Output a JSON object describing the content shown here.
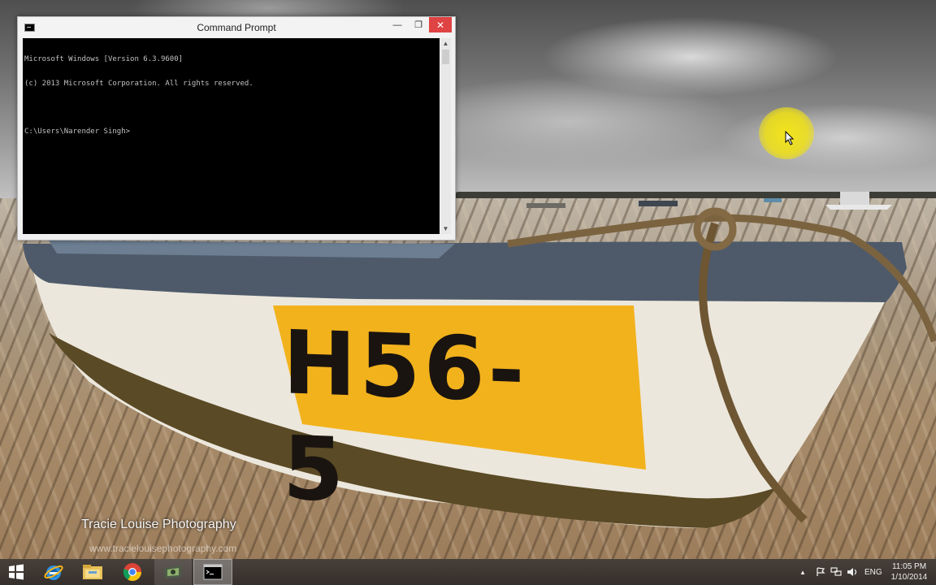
{
  "window": {
    "title": "Command Prompt",
    "minimize_glyph": "—",
    "maximize_glyph": "❐",
    "close_glyph": "✕"
  },
  "console": {
    "lines": [
      "Microsoft Windows [Version 6.3.9600]",
      "(c) 2013 Microsoft Corporation. All rights reserved.",
      "",
      "C:\\Users\\Narender Singh>"
    ]
  },
  "wallpaper": {
    "boat_number": "H56-5",
    "watermark_title": "Tracie Louise Photography",
    "watermark_url": "www.tracielouisephotography.com"
  },
  "taskbar": {
    "apps": [
      "start-icon",
      "internet-explorer-icon",
      "file-explorer-icon",
      "chrome-icon",
      "app-icon",
      "command-prompt-icon"
    ],
    "tray": {
      "expand_glyph": "▲",
      "language": "ENG",
      "time": "11:05 PM",
      "date": "1/10/2014"
    }
  },
  "colors": {
    "close_button": "#e04343",
    "console_background": "#000000",
    "console_text": "#c0c0c0",
    "cursor_highlight": "#f0e114"
  }
}
